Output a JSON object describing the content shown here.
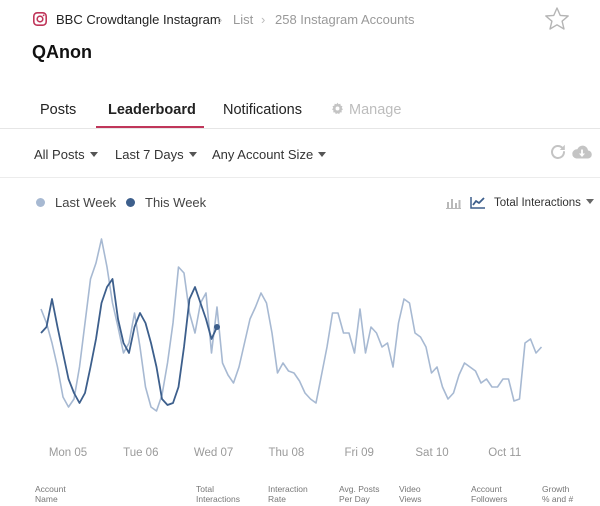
{
  "header": {
    "breadcrumb": [
      "BBC Crowdtangle Instagram",
      "List",
      "258 Instagram Accounts"
    ],
    "title": "QAnon",
    "icons": {
      "brand": "instagram-icon",
      "favorite": "star-icon"
    }
  },
  "tabs": [
    {
      "label": "Posts",
      "active": false
    },
    {
      "label": "Leaderboard",
      "active": true
    },
    {
      "label": "Notifications",
      "active": false
    },
    {
      "label": "Manage",
      "active": false,
      "disabled": true,
      "icon": "gear-icon"
    }
  ],
  "filters": [
    {
      "label": "All Posts"
    },
    {
      "label": "Last 7 Days"
    },
    {
      "label": "Any Account Size"
    }
  ],
  "toolbar": {
    "icons": [
      "refresh-icon",
      "cloud-download-icon"
    ]
  },
  "chart_controls": {
    "view_icons": [
      "bar-chart-icon",
      "line-chart-icon"
    ],
    "active_view": "line",
    "metric": "Total Interactions"
  },
  "colors": {
    "accent": "#c0365a",
    "last_week": "#a7b9d2",
    "this_week": "#3d5f8c"
  },
  "chart_data": {
    "type": "line",
    "x_tick_labels": [
      "Mon 05",
      "Tue 06",
      "Wed 07",
      "Thu 08",
      "Fri 09",
      "Sat 10",
      "Oct 11"
    ],
    "legend_position": "top-left",
    "grid": false,
    "y_axis_labels_shown": false,
    "series": [
      {
        "name": "Last Week",
        "color": "#a7b9d2",
        "values": [
          57,
          50,
          40,
          28,
          13,
          8,
          12,
          28,
          50,
          72,
          80,
          92,
          78,
          60,
          48,
          35,
          40,
          55,
          38,
          18,
          8,
          6,
          14,
          30,
          50,
          78,
          75,
          55,
          45,
          60,
          65,
          35,
          58,
          30,
          24,
          20,
          28,
          40,
          52,
          58,
          65,
          60,
          45,
          25,
          30,
          26,
          25,
          21,
          15,
          12,
          10,
          24,
          38,
          55,
          55,
          45,
          45,
          35,
          57,
          35,
          48,
          45,
          38,
          40,
          28,
          50,
          62,
          60,
          45,
          43,
          38,
          25,
          28,
          18,
          12,
          15,
          24,
          30,
          28,
          26,
          20,
          22,
          18,
          18,
          22,
          22,
          11,
          12,
          40,
          42,
          35,
          38
        ]
      },
      {
        "name": "This Week",
        "color": "#3d5f8c",
        "values": [
          45,
          48,
          62,
          48,
          35,
          22,
          15,
          10,
          15,
          28,
          42,
          60,
          68,
          72,
          52,
          40,
          35,
          48,
          55,
          50,
          40,
          28,
          12,
          9,
          10,
          18,
          38,
          62,
          68,
          60,
          52,
          42,
          48
        ]
      }
    ]
  },
  "table_columns": [
    "Account\nName",
    "Total\nInteractions",
    "Interaction\nRate",
    "Avg. Posts\nPer Day",
    "Video\nViews",
    "Account\nFollowers",
    "Growth\n% and #"
  ]
}
